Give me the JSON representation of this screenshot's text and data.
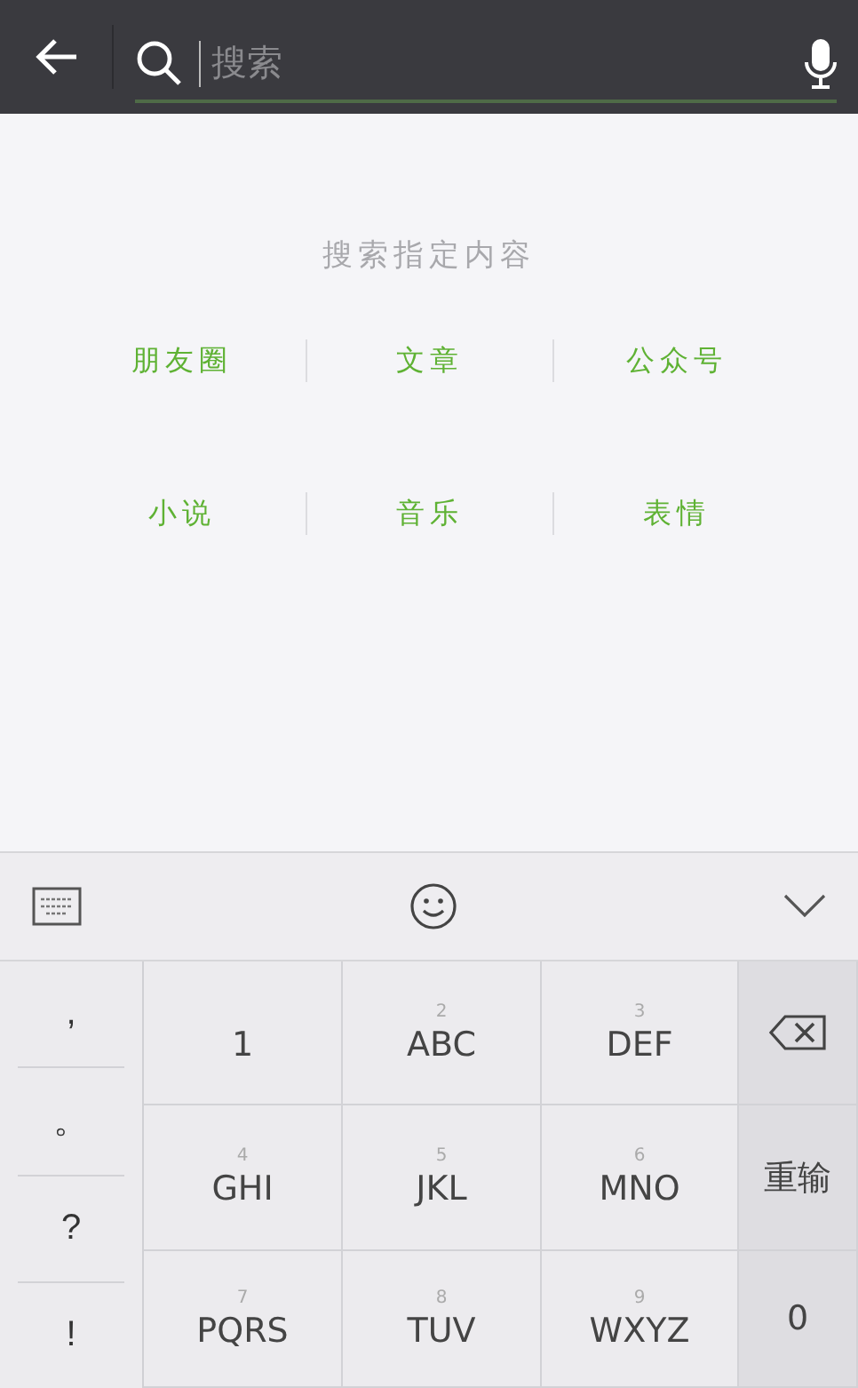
{
  "search_bar": {
    "placeholder": "搜索"
  },
  "prompt": "搜索指定内容",
  "categories": [
    {
      "label": "朋友圈"
    },
    {
      "label": "文章"
    },
    {
      "label": "公众号"
    },
    {
      "label": "小说"
    },
    {
      "label": "音乐"
    },
    {
      "label": "表情"
    }
  ],
  "keyboard": {
    "symbols": [
      ",",
      "。",
      "?",
      "!"
    ],
    "keys": [
      {
        "label": "1"
      },
      {
        "number": "2",
        "label": "ABC"
      },
      {
        "number": "3",
        "label": "DEF"
      },
      {
        "kind": "backspace"
      },
      {
        "number": "4",
        "label": "GHI"
      },
      {
        "number": "5",
        "label": "JKL"
      },
      {
        "number": "6",
        "label": "MNO"
      },
      {
        "kind": "text",
        "label": "重输"
      },
      {
        "number": "7",
        "label": "PQRS"
      },
      {
        "number": "8",
        "label": "TUV"
      },
      {
        "number": "9",
        "label": "WXYZ"
      },
      {
        "kind": "text",
        "label": "0"
      }
    ]
  }
}
